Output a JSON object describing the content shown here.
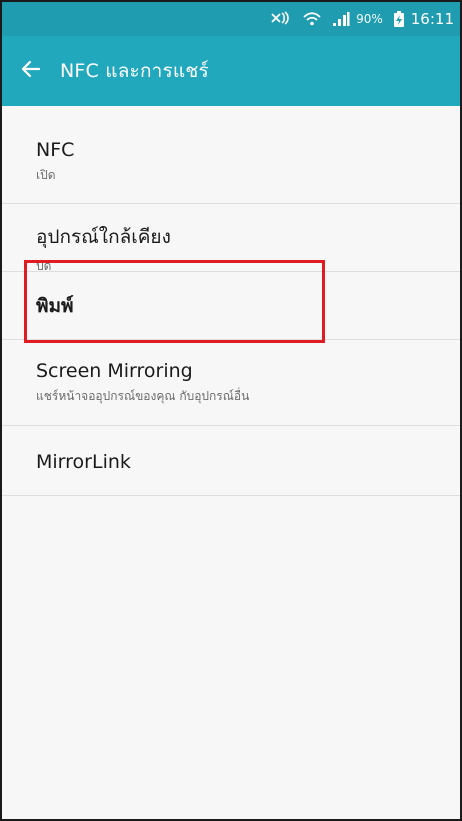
{
  "status_bar": {
    "battery_percent": "90%",
    "time": "16:11",
    "icons": [
      "mute-icon",
      "wifi-icon",
      "signal-icon",
      "battery-charging-icon"
    ]
  },
  "app_bar": {
    "back_icon": "arrow-left-icon",
    "title": "NFC และการแชร์",
    "background": "#22a8bd"
  },
  "settings": {
    "nfc": {
      "label": "NFC",
      "sub": "เปิด"
    },
    "nearby": {
      "label": "อุปกรณ์ใกล้เคียง",
      "sub": "ปิด"
    },
    "print": {
      "label": "พิมพ์"
    },
    "screen_mirroring": {
      "label": "Screen Mirroring",
      "sub": "แชร์หน้าจออุปกรณ์ของคุณ กับอุปกรณ์อื่น"
    },
    "mirrorlink": {
      "label": "MirrorLink"
    }
  },
  "highlight": {
    "target": "screen_mirroring",
    "color": "#e11b22"
  }
}
